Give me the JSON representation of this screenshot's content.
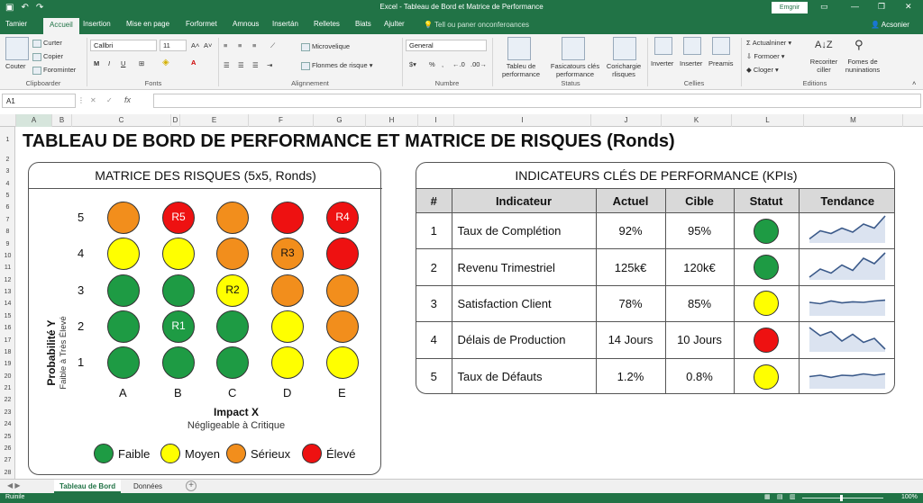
{
  "app": {
    "window_title": "Excel - Tableau de Bord et Matrice de Performance",
    "sign_in": "Emgnir",
    "share": "Acsonier"
  },
  "ribbon_tabs": [
    {
      "label": "Tamier",
      "active": false
    },
    {
      "label": "Accueil",
      "active": true
    },
    {
      "label": "Insertion",
      "active": false
    },
    {
      "label": "Mise en page",
      "active": false
    },
    {
      "label": "Forformet",
      "active": false
    },
    {
      "label": "Amnous",
      "active": false
    },
    {
      "label": "Insertán",
      "active": false
    },
    {
      "label": "Relletes",
      "active": false
    },
    {
      "label": "Biats",
      "active": false
    },
    {
      "label": "Ajulter",
      "active": false
    }
  ],
  "tell_me": "Tell ou paner onconferoances",
  "ribbon": {
    "clipboard": {
      "paste": "Couter",
      "cut": "Curter",
      "copy": "Copier",
      "format": "Forominter",
      "group": "Clipboarder"
    },
    "fonts": {
      "font_name": "Callbri",
      "font_size": "11",
      "bold": "M",
      "italic": "I",
      "underline": "U",
      "group": "Fonts"
    },
    "alignment": {
      "wrap": "Microvelique",
      "merge": "Flonmes de risque",
      "group": "Alignnement"
    },
    "number": {
      "format": "General",
      "group": "Numbre"
    },
    "status": {
      "table": "Tableu de performance",
      "conditional": "Fasicatours clés performance",
      "charts": "Corichargie rlisques",
      "group": "Status"
    },
    "cells": {
      "insert1": "Inverter",
      "insert2": "Inserter",
      "preamis": "Preamis",
      "group": "Cellies"
    },
    "editing": {
      "autosum": "Actualniner",
      "fill": "Formoer",
      "clear": "Cloger",
      "sort": "Recoriter ciller",
      "find": "Fomes de nuninations",
      "group": "Editions"
    }
  },
  "formula_bar": {
    "name_box": "A1",
    "fx": "fx",
    "value": ""
  },
  "columns": [
    "A",
    "B",
    "C",
    "D",
    "E",
    "F",
    "G",
    "H",
    "I",
    "I",
    "J",
    "K",
    "L",
    "M"
  ],
  "rows": [
    "1",
    "2",
    "3",
    "4",
    "5",
    "6",
    "7",
    "8",
    "9",
    "10",
    "11",
    "12",
    "13",
    "14",
    "15",
    "16",
    "17",
    "18",
    "19",
    "20",
    "21",
    "22",
    "23",
    "24",
    "25",
    "26",
    "27",
    "28"
  ],
  "page_title": "TABLEAU DE BORD DE PERFORMANCE ET MATRICE DE RISQUES (Ronds)",
  "matrix": {
    "title": "MATRICE DES RISQUES (5x5, Ronds)",
    "y_levels": [
      "5",
      "4",
      "3",
      "2",
      "1"
    ],
    "x_levels": [
      "A",
      "B",
      "C",
      "D",
      "E"
    ],
    "y_axis_title": "Probabilité Y",
    "y_axis_sub": "Faible à Très Élevé",
    "x_axis_title": "Impact X",
    "x_axis_sub": "Négligeable à Critique",
    "colors": {
      "green": "#1e9b44",
      "yellow": "#ffff00",
      "orange": "#f28e1c",
      "red": "#ee1111"
    },
    "grid": [
      [
        {
          "c": "orange",
          "t": ""
        },
        {
          "c": "red",
          "t": "R5"
        },
        {
          "c": "orange",
          "t": ""
        },
        {
          "c": "red",
          "t": ""
        },
        {
          "c": "red",
          "t": "R4"
        }
      ],
      [
        {
          "c": "yellow",
          "t": ""
        },
        {
          "c": "yellow",
          "t": ""
        },
        {
          "c": "orange",
          "t": ""
        },
        {
          "c": "orange",
          "t": "R3"
        },
        {
          "c": "red",
          "t": ""
        }
      ],
      [
        {
          "c": "green",
          "t": ""
        },
        {
          "c": "green",
          "t": ""
        },
        {
          "c": "yellow",
          "t": "R2"
        },
        {
          "c": "orange",
          "t": ""
        },
        {
          "c": "orange",
          "t": ""
        }
      ],
      [
        {
          "c": "green",
          "t": ""
        },
        {
          "c": "green",
          "t": "R1"
        },
        {
          "c": "green",
          "t": ""
        },
        {
          "c": "yellow",
          "t": ""
        },
        {
          "c": "orange",
          "t": ""
        }
      ],
      [
        {
          "c": "green",
          "t": ""
        },
        {
          "c": "green",
          "t": ""
        },
        {
          "c": "green",
          "t": ""
        },
        {
          "c": "yellow",
          "t": ""
        },
        {
          "c": "yellow",
          "t": ""
        }
      ]
    ],
    "legend": [
      {
        "label": "Faible",
        "color": "green"
      },
      {
        "label": "Moyen",
        "color": "yellow"
      },
      {
        "label": "Sérieux",
        "color": "orange"
      },
      {
        "label": "Élevé",
        "color": "red"
      }
    ]
  },
  "kpi": {
    "title": "INDICATEURS CLÉS DE PERFORMANCE (KPIs)",
    "headers": [
      "#",
      "Indicateur",
      "Actuel",
      "Cible",
      "Statut",
      "Tendance"
    ],
    "rows": [
      {
        "num": "1",
        "label": "Taux de Complétion",
        "actual": "92%",
        "target": "95%",
        "status": "green",
        "trend": [
          0.15,
          0.45,
          0.35,
          0.55,
          0.4,
          0.7,
          0.55,
          1.0
        ]
      },
      {
        "num": "2",
        "label": "Revenu Trimestriel",
        "actual": "125k€",
        "target": "120k€",
        "status": "green",
        "trend": [
          0.1,
          0.4,
          0.25,
          0.55,
          0.35,
          0.8,
          0.6,
          1.0
        ]
      },
      {
        "num": "3",
        "label": "Satisfaction Client",
        "actual": "78%",
        "target": "85%",
        "status": "yellow",
        "trend": [
          0.5,
          0.45,
          0.55,
          0.48,
          0.52,
          0.5,
          0.55,
          0.58
        ]
      },
      {
        "num": "4",
        "label": "Délais de Production",
        "actual": "14 Jours",
        "target": "10 Jours",
        "status": "red",
        "trend": [
          0.9,
          0.6,
          0.75,
          0.4,
          0.65,
          0.35,
          0.5,
          0.1
        ]
      },
      {
        "num": "5",
        "label": "Taux de Défauts",
        "actual": "1.2%",
        "target": "0.8%",
        "status": "yellow",
        "trend": [
          0.45,
          0.5,
          0.42,
          0.5,
          0.48,
          0.55,
          0.5,
          0.55
        ]
      }
    ]
  },
  "sheet_tabs": [
    {
      "label": "Tableau de Bord",
      "active": true
    },
    {
      "label": "Données",
      "active": false
    }
  ],
  "status": {
    "ready": "Ruinile",
    "zoom": "100%"
  }
}
